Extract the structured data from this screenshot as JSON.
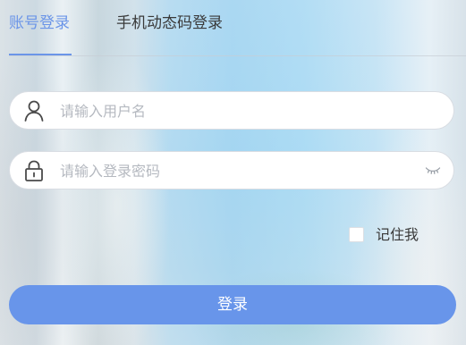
{
  "tabs": [
    {
      "label": "账号登录",
      "active": true
    },
    {
      "label": "手机动态码登录",
      "active": false
    }
  ],
  "form": {
    "username": {
      "value": "",
      "placeholder": "请输入用户名",
      "icon": "user-icon"
    },
    "password": {
      "value": "",
      "placeholder": "请输入登录密码",
      "icon": "lock-icon",
      "toggle_icon": "eye-closed-icon"
    },
    "remember": {
      "label": "记住我",
      "checked": false
    },
    "submit_label": "登录"
  },
  "colors": {
    "accent": "#6b95e8",
    "button": "#6895ea",
    "text": "#3a3a3a",
    "placeholder": "#b5b9c0"
  }
}
